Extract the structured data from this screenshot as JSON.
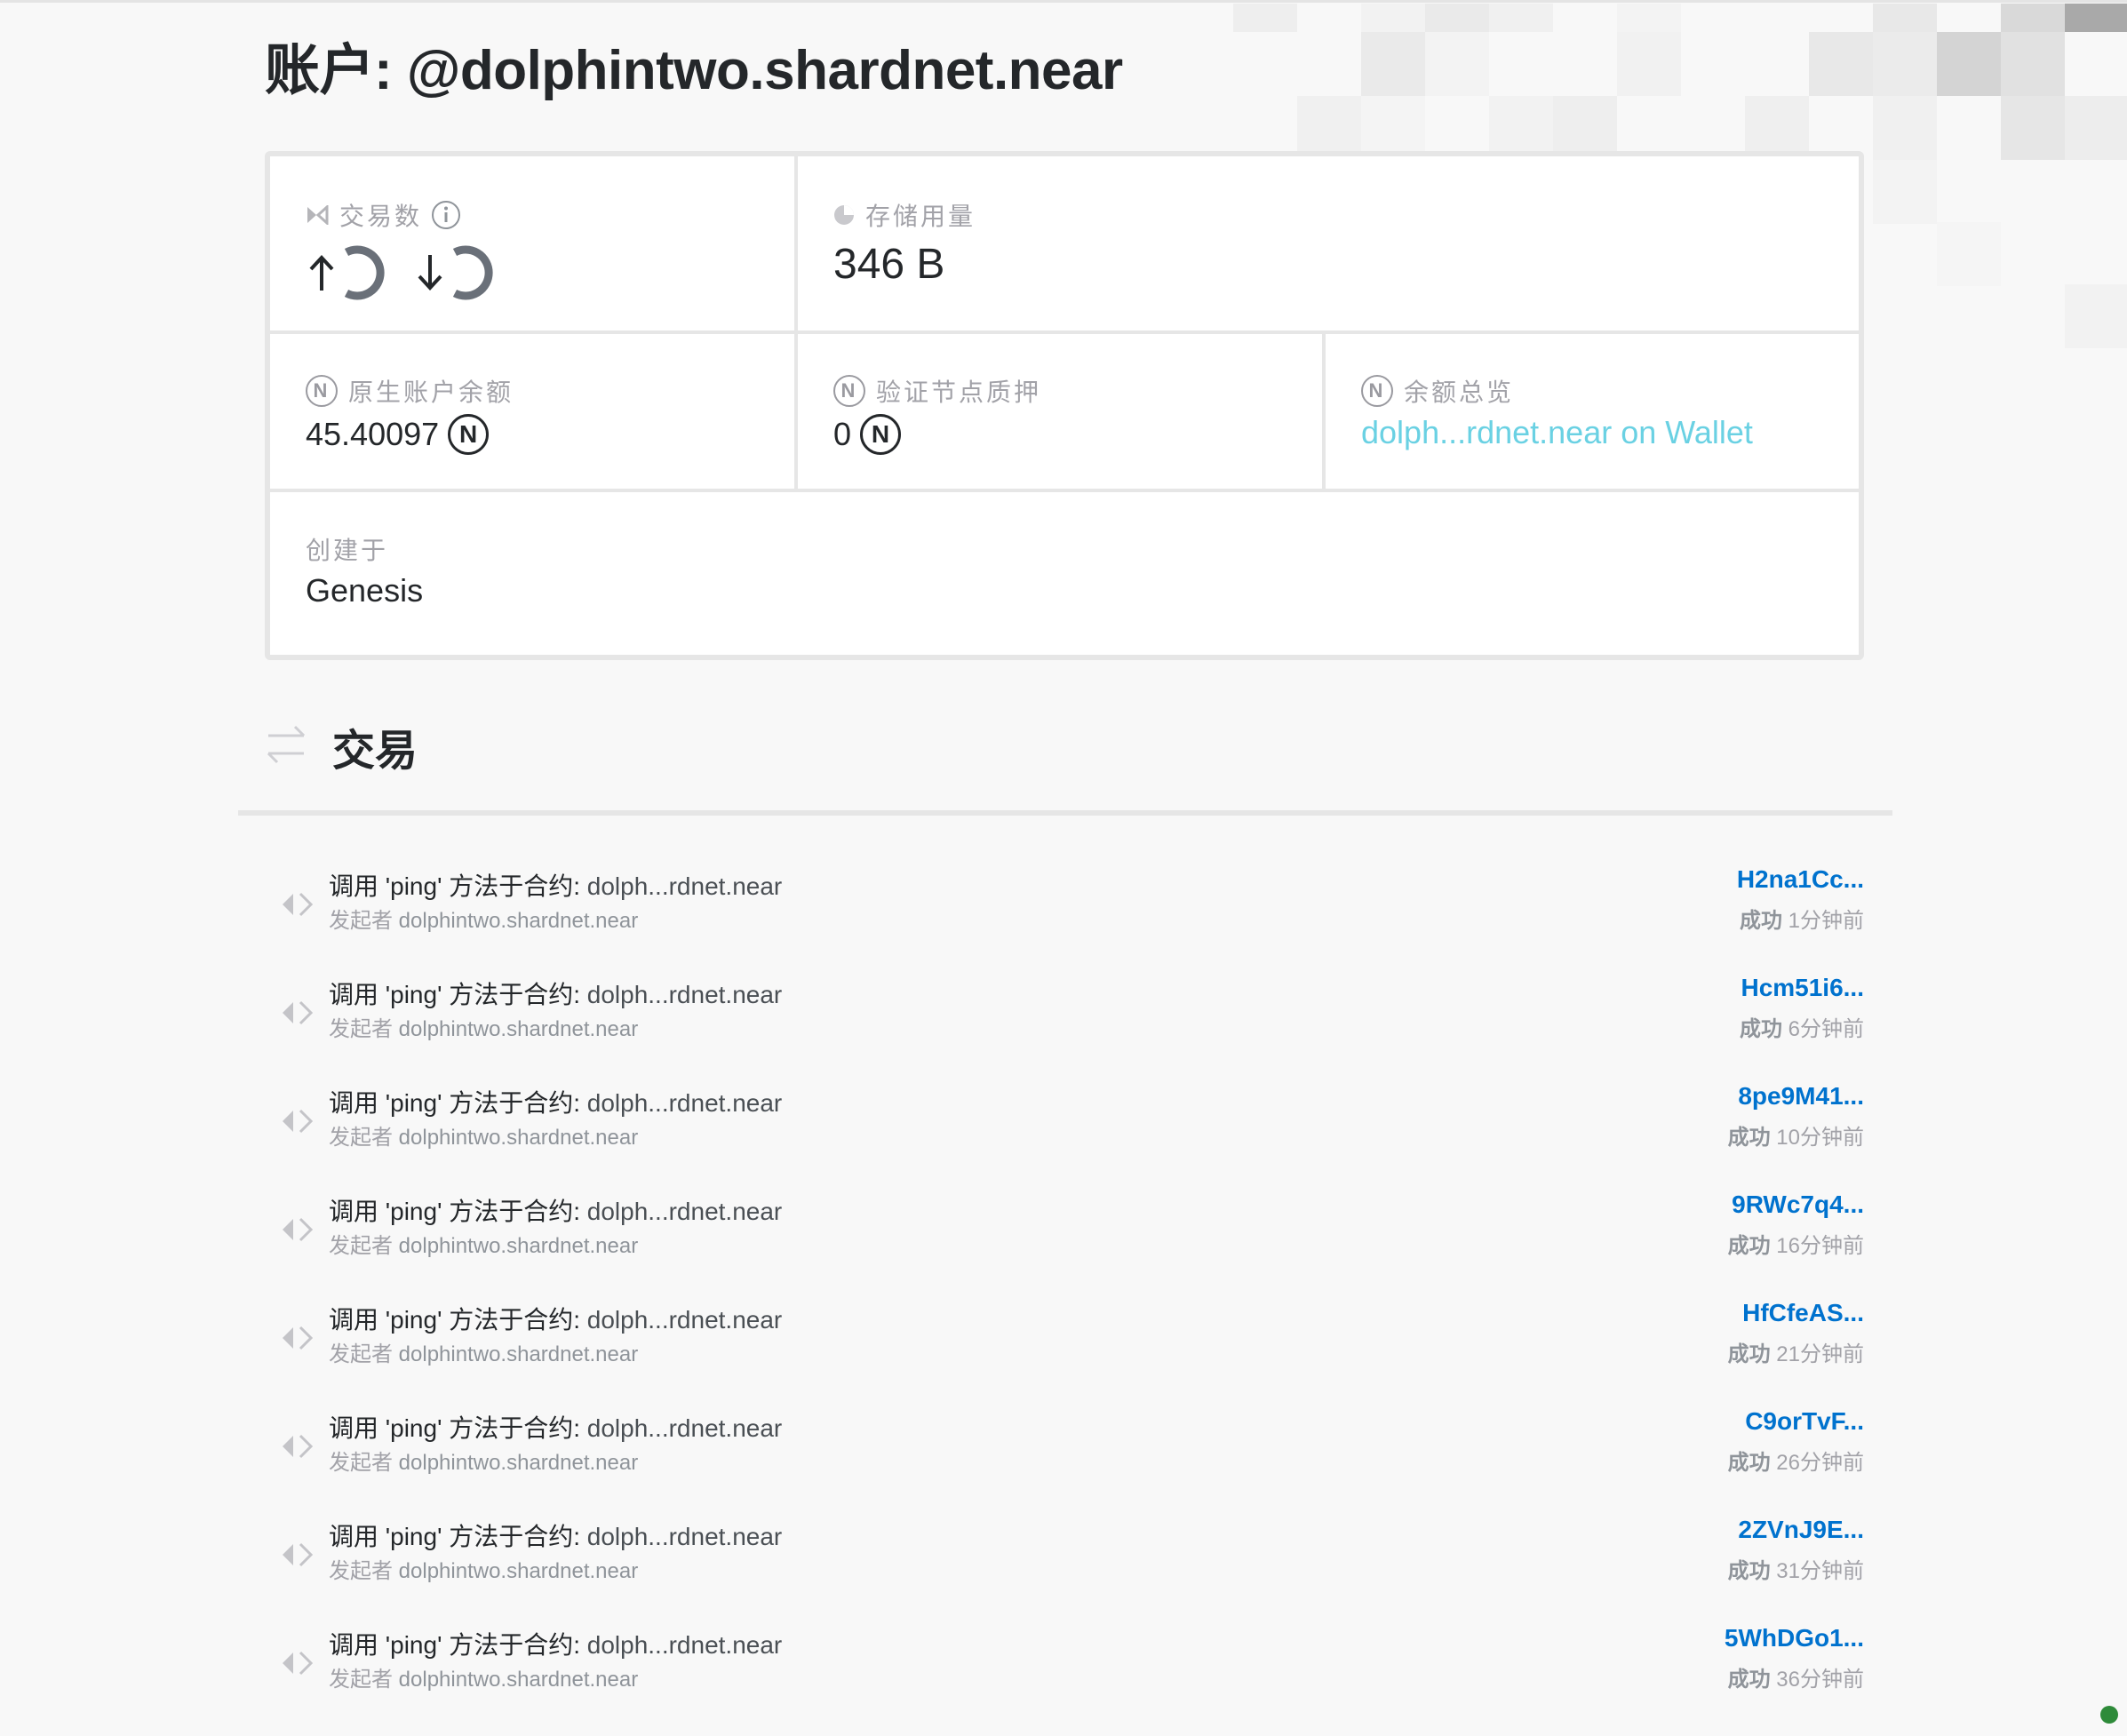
{
  "page": {
    "title_prefix": "账户: ",
    "account": "@dolphintwo.shardnet.near"
  },
  "info": {
    "tx_count": {
      "label": "交易数",
      "icon": "transactions-icon"
    },
    "storage": {
      "label": "存储用量",
      "value": "346 B"
    },
    "native_balance": {
      "label": "原生账户余额",
      "value": "45.40097"
    },
    "validator_stake": {
      "label": "验证节点质押",
      "value": "0"
    },
    "balance_overview": {
      "label": "余额总览",
      "link": "dolph...rdnet.near on Wallet"
    },
    "created": {
      "label": "创建于",
      "value": "Genesis"
    },
    "coin_symbol": "N"
  },
  "transactions": {
    "title": "交易",
    "items": [
      {
        "action": "调用 'ping' 方法于合约: ",
        "contract": "dolph...rdnet.near",
        "signer_label": "发起者 ",
        "signer": "dolphintwo.shardnet.near",
        "hash": "H2na1Cc...",
        "status": "成功",
        "time": " 1分钟前"
      },
      {
        "action": "调用 'ping' 方法于合约: ",
        "contract": "dolph...rdnet.near",
        "signer_label": "发起者 ",
        "signer": "dolphintwo.shardnet.near",
        "hash": "Hcm51i6...",
        "status": "成功",
        "time": " 6分钟前"
      },
      {
        "action": "调用 'ping' 方法于合约: ",
        "contract": "dolph...rdnet.near",
        "signer_label": "发起者 ",
        "signer": "dolphintwo.shardnet.near",
        "hash": "8pe9M41...",
        "status": "成功",
        "time": " 10分钟前"
      },
      {
        "action": "调用 'ping' 方法于合约: ",
        "contract": "dolph...rdnet.near",
        "signer_label": "发起者 ",
        "signer": "dolphintwo.shardnet.near",
        "hash": "9RWc7q4...",
        "status": "成功",
        "time": " 16分钟前"
      },
      {
        "action": "调用 'ping' 方法于合约: ",
        "contract": "dolph...rdnet.near",
        "signer_label": "发起者 ",
        "signer": "dolphintwo.shardnet.near",
        "hash": "HfCfeAS...",
        "status": "成功",
        "time": " 21分钟前"
      },
      {
        "action": "调用 'ping' 方法于合约: ",
        "contract": "dolph...rdnet.near",
        "signer_label": "发起者 ",
        "signer": "dolphintwo.shardnet.near",
        "hash": "C9orTvF...",
        "status": "成功",
        "time": " 26分钟前"
      },
      {
        "action": "调用 'ping' 方法于合约: ",
        "contract": "dolph...rdnet.near",
        "signer_label": "发起者 ",
        "signer": "dolphintwo.shardnet.near",
        "hash": "2ZVnJ9E...",
        "status": "成功",
        "time": " 31分钟前"
      },
      {
        "action": "调用 'ping' 方法于合约: ",
        "contract": "dolph...rdnet.near",
        "signer_label": "发起者 ",
        "signer": "dolphintwo.shardnet.near",
        "hash": "5WhDGo1...",
        "status": "成功",
        "time": " 36分钟前"
      }
    ]
  },
  "colors": {
    "link_blue": "#0072ce",
    "link_cyan": "#6ad1e3",
    "text": "#24272a",
    "muted": "#a2a2a8"
  }
}
